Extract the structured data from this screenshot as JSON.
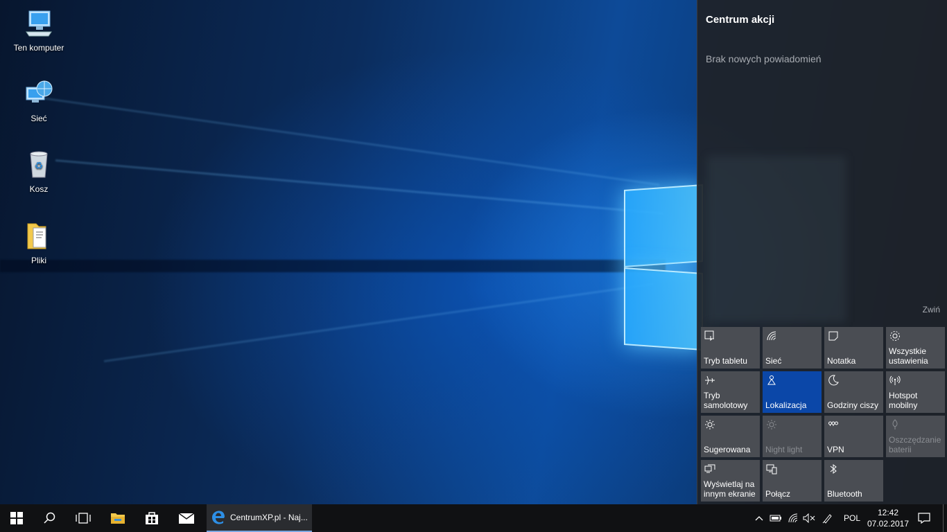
{
  "desktop": {
    "icons": [
      {
        "label": "Ten komputer",
        "icon": "computer-icon"
      },
      {
        "label": "Sieć",
        "icon": "network-icon"
      },
      {
        "label": "Kosz",
        "icon": "recycle-bin-icon"
      },
      {
        "label": "Pliki",
        "icon": "folder-icon"
      }
    ]
  },
  "action_center": {
    "title": "Centrum akcji",
    "empty_message": "Brak nowych powiadomień",
    "collapse_label": "Zwiń",
    "tiles": [
      {
        "label": "Tryb tabletu",
        "icon": "tablet-mode-icon",
        "state": "off"
      },
      {
        "label": "Sieć",
        "icon": "wifi-icon",
        "state": "off"
      },
      {
        "label": "Notatka",
        "icon": "note-icon",
        "state": "off"
      },
      {
        "label": "Wszystkie ustawienia",
        "icon": "gear-icon",
        "state": "off"
      },
      {
        "label": "Tryb samolotowy",
        "icon": "airplane-icon",
        "state": "off"
      },
      {
        "label": "Lokalizacja",
        "icon": "location-icon",
        "state": "on"
      },
      {
        "label": "Godziny ciszy",
        "icon": "moon-icon",
        "state": "off"
      },
      {
        "label": "Hotspot mobilny",
        "icon": "hotspot-icon",
        "state": "off"
      },
      {
        "label": "Sugerowana",
        "icon": "brightness-icon",
        "state": "off"
      },
      {
        "label": "Night light",
        "icon": "night-light-icon",
        "state": "disabled"
      },
      {
        "label": "VPN",
        "icon": "vpn-icon",
        "state": "off"
      },
      {
        "label": "Oszczędzanie baterii",
        "icon": "battery-saver-icon",
        "state": "disabled"
      },
      {
        "label": "Wyświetlaj na innym ekranie",
        "icon": "project-icon",
        "state": "off"
      },
      {
        "label": "Połącz",
        "icon": "connect-icon",
        "state": "off"
      },
      {
        "label": "Bluetooth",
        "icon": "bluetooth-icon",
        "state": "off"
      }
    ]
  },
  "taskbar": {
    "running_app_label": "CentrumXP.pl - Naj...",
    "language": "POL",
    "time": "12:42",
    "date": "07.02.2017"
  },
  "colors": {
    "active_tile": "#0b47a8",
    "tile": "#4a4d53",
    "action_center_bg": "#1f2228",
    "taskbar": "#101113"
  }
}
